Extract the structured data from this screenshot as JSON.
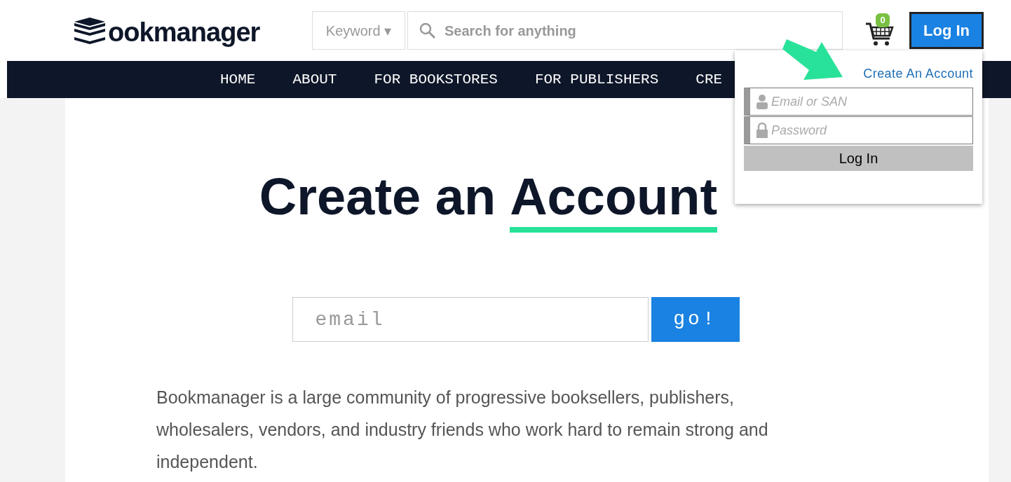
{
  "header": {
    "logo_text": "ookmanager",
    "search_scope": "Keyword ▾",
    "search_placeholder": "Search for anything",
    "cart_count": "0",
    "login_button": "Log In"
  },
  "nav": [
    {
      "label": "HOME"
    },
    {
      "label": "ABOUT"
    },
    {
      "label": "FOR BOOKSTORES"
    },
    {
      "label": "FOR PUBLISHERS"
    },
    {
      "label": "CRE"
    }
  ],
  "login_popup": {
    "create_link": "Create An Account",
    "email_placeholder": "Email or SAN",
    "password_placeholder": "Password",
    "submit": "Log In"
  },
  "main": {
    "title_plain": "Create an",
    "title_underlined": "Account",
    "email_placeholder": "email",
    "go_button": "go!",
    "description": "Bookmanager is a large community of progressive booksellers, publishers, wholesalers, vendors, and industry friends who work hard to remain strong and independent."
  }
}
